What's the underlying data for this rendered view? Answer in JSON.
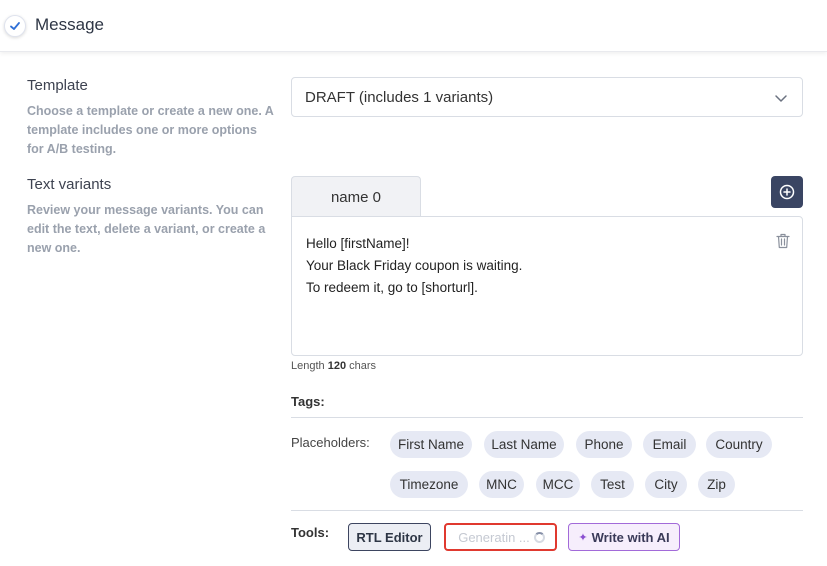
{
  "header": {
    "title": "Message"
  },
  "template": {
    "label": "Template",
    "description": "Choose a template or create a new one. A template includes one or more options for A/B testing.",
    "selected": "DRAFT (includes 1 variants)"
  },
  "text_variants": {
    "label": "Text variants",
    "description": "Review your message variants. You can edit the text, delete a variant, or create a new one.",
    "tabs": [
      {
        "label": "name 0"
      }
    ],
    "message_lines": [
      "Hello [firstName]!",
      "Your Black Friday coupon is waiting.",
      "To redeem it, go to [shorturl]."
    ],
    "length_prefix": "Length",
    "length_value": "120",
    "length_suffix": "chars"
  },
  "tags": {
    "label": "Tags:",
    "placeholders_label": "Placeholders:",
    "placeholders": [
      "First Name",
      "Last Name",
      "Phone",
      "Email",
      "Country",
      "Timezone",
      "MNC",
      "MCC",
      "Test",
      "City",
      "Zip"
    ]
  },
  "tools": {
    "label": "Tools:",
    "rtl_editor": "RTL Editor",
    "generating": "Generatin ...",
    "write_with_ai": "Write with AI"
  },
  "colors": {
    "accent_dark": "#3a4563",
    "chip_bg": "#e6e9f4",
    "ai_border": "#a26ad9",
    "highlight_red": "#e0392f"
  },
  "icons": {
    "check": "check-icon",
    "chevron": "chevron-down-icon",
    "add": "plus-circle-icon",
    "trash": "trash-icon",
    "sparkle": "sparkle-icon"
  }
}
